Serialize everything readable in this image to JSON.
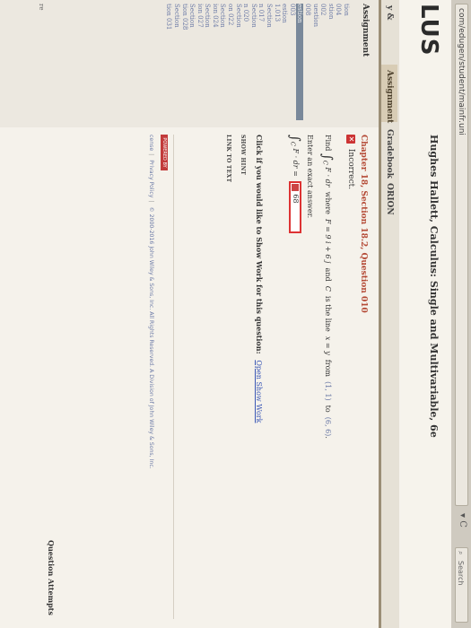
{
  "browser": {
    "url": "com/edugen/student/mainfr.uni",
    "nav_icons": "▾ C",
    "search_placeholder": "Search"
  },
  "header": {
    "logo": "LUS",
    "course_title": "Hughes Hallett, Calculus: Single and Multivariable, 6e"
  },
  "tabs": [
    {
      "label": "y & Practice"
    },
    {
      "label": "Assignment"
    },
    {
      "label": "Gradebook"
    },
    {
      "label": "ORION"
    }
  ],
  "left": {
    "title": "Assignment",
    "items": [
      "tion",
      "004",
      "stion",
      "002",
      "uestion",
      "008",
      "estion",
      "003",
      "estion",
      "1.013",
      "Section",
      "n 017",
      "Section",
      "n 020",
      "Section",
      "on 022",
      "Section",
      "ion 024",
      "Section",
      "ion 027",
      "Section",
      "tion 028",
      "Section",
      "tion 031"
    ],
    "selected_index": 6,
    "footer": "re"
  },
  "main": {
    "question_title": "Chapter 18, Section 18.2, Question 010",
    "status": "Incorrect.",
    "problem": {
      "find": "Find",
      "integral_expr": "F · dr",
      "where": "where",
      "field": "F = 9 i + 6 j",
      "and": "and",
      "curve_var": "C",
      "is_line": "is the line",
      "line_eq": "x = y",
      "from": "from",
      "point_a": "(1, 1)",
      "to": "to",
      "point_b": "(6, 6)"
    },
    "enter": "Enter an exact answer.",
    "answer_lhs": "F · dr =",
    "answer_value": "68",
    "show_work_prompt": "Click if you would like to Show Work for this question:",
    "show_work_link": "Open Show Work",
    "show_hint": "SHOW HINT",
    "link_to_text": "LINK TO TEXT",
    "powered_by": "POWERED BY",
    "footer_links": [
      "cense",
      "Privacy Policy",
      "© 2000-2016 John Wiley & Sons, Inc. All Rights Reserved. A Division of John Wiley & Sons, Inc."
    ],
    "question_attempts": "Question Attempts"
  }
}
